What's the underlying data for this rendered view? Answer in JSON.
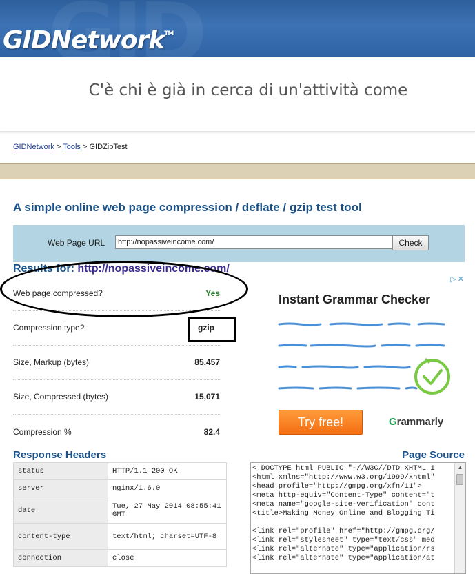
{
  "header": {
    "logo": "GIDNetwork",
    "trademark": "TM"
  },
  "banner": {
    "text": "C'è chi è già in cerca di un'attività come"
  },
  "breadcrumb": {
    "root": "GIDNetwork",
    "sep1": " > ",
    "tools": "Tools",
    "sep2": " > ",
    "current": "GIDZipTest"
  },
  "page": {
    "title": "A simple online web page compression / deflate / gzip test tool"
  },
  "form": {
    "label": "Web Page URL",
    "url_value": "http://nopassiveincome.com/",
    "check_label": "Check"
  },
  "results": {
    "heading_prefix": "Results for: ",
    "url": "http://nopassiveincome.com/",
    "rows": [
      {
        "label": "Web page compressed?",
        "value": "Yes"
      },
      {
        "label": "Compression type?",
        "value": "gzip"
      },
      {
        "label": "Size, Markup (bytes)",
        "value": "85,457"
      },
      {
        "label": "Size, Compressed (bytes)",
        "value": "15,071"
      },
      {
        "label": "Compression %",
        "value": "82.4"
      }
    ]
  },
  "ad": {
    "headline": "Instant Grammar Checker",
    "cta": "Try free!",
    "brand": "Grammarly",
    "brand_initial": "G",
    "brand_rest": "rammarly"
  },
  "response_headers": {
    "title": "Response Headers",
    "rows": [
      {
        "key": "status",
        "value": "HTTP/1.1 200 OK"
      },
      {
        "key": "server",
        "value": "nginx/1.6.0"
      },
      {
        "key": "date",
        "value": "Tue, 27 May 2014 08:55:41 GMT"
      },
      {
        "key": "content-type",
        "value": "text/html; charset=UTF-8"
      },
      {
        "key": "connection",
        "value": "close"
      }
    ]
  },
  "page_source": {
    "title": "Page Source",
    "lines": [
      "<!DOCTYPE html PUBLIC \"-//W3C//DTD XHTML 1",
      "<html xmlns=\"http://www.w3.org/1999/xhtml\"",
      "<head profile=\"http://gmpg.org/xfn/11\">",
      "<meta http-equiv=\"Content-Type\" content=\"t",
      "<meta name=\"google-site-verification\" cont",
      "<title>Making Money Online and Blogging Ti",
      "",
      "<link rel=\"profile\" href=\"http://gmpg.org/",
      "<link rel=\"stylesheet\" type=\"text/css\" med",
      "<link rel=\"alternate\" type=\"application/rs",
      "<link rel=\"alternate\" type=\"application/at"
    ]
  },
  "colors": {
    "header_blue": "#3d73b4",
    "title_blue": "#1a5189",
    "form_bg": "#b3d5e3",
    "tan_bar": "#ddd1b5",
    "ad_orange": "#f36e12",
    "yes_green": "#2e7d2e"
  }
}
